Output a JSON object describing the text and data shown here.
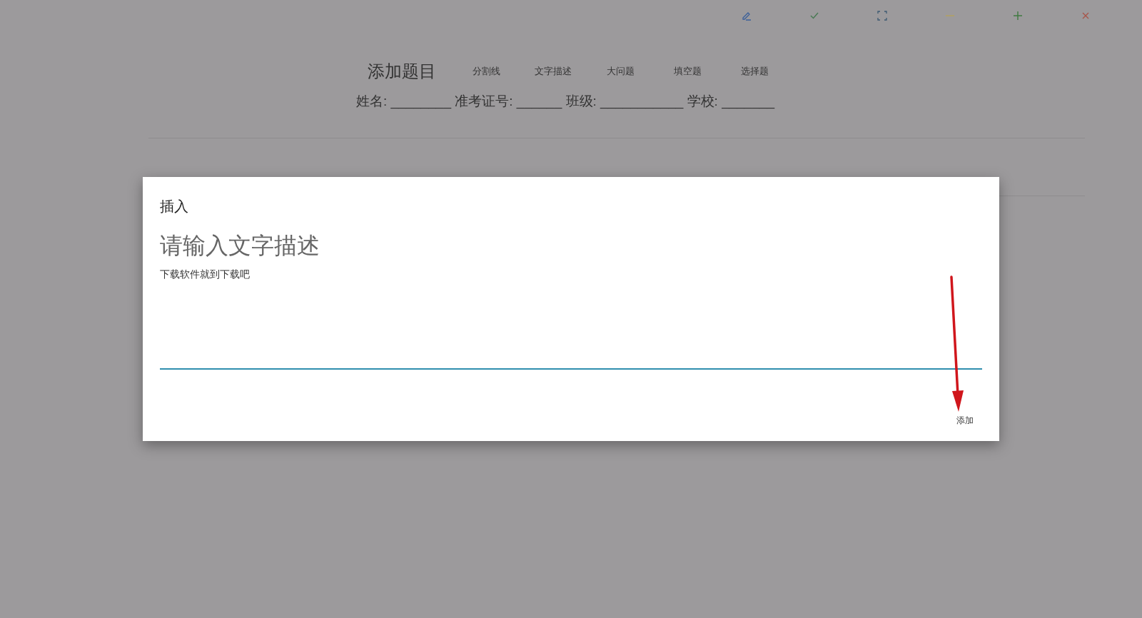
{
  "toolbar": [
    {
      "kind": "edit"
    },
    {
      "kind": "check"
    },
    {
      "kind": "fullscreen"
    },
    {
      "kind": "minimize"
    },
    {
      "kind": "add"
    },
    {
      "kind": "close"
    }
  ],
  "header": {
    "title": "添加题目",
    "actions": [
      "分割线",
      "文字描述",
      "大问题",
      "填空题",
      "选择题"
    ]
  },
  "info_line": "姓名: ________ 准考证号: ______ 班级: ___________ 学校: _______",
  "dialog": {
    "title": "插入",
    "field": {
      "placeholder": "请输入文字描述",
      "value": "下载软件就到下载吧"
    },
    "button": "添加"
  }
}
